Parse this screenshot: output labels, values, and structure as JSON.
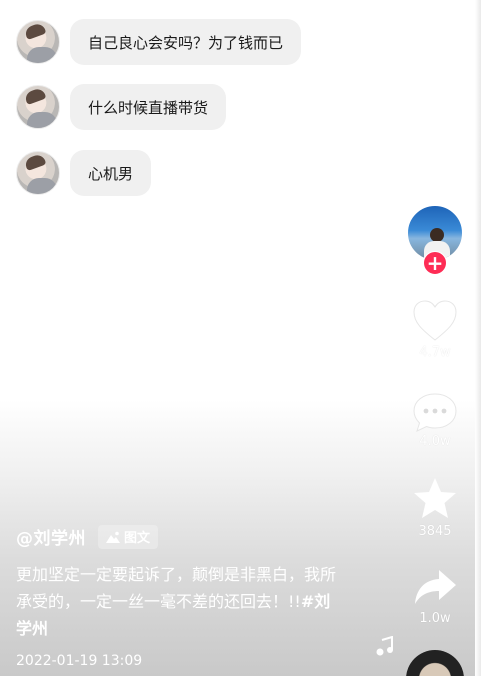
{
  "comments": [
    {
      "text": "自己良心会安吗？为了钱而已",
      "avatar_icon": "user-avatar"
    },
    {
      "text": "什么时候直播带货",
      "avatar_icon": "user-avatar"
    },
    {
      "text": "心机男",
      "avatar_icon": "user-avatar"
    }
  ],
  "rail": {
    "follow_symbol": "+",
    "likes": "4.7w",
    "comments": "4.0w",
    "favorites": "3845",
    "shares": "1.0w",
    "icons": [
      "heart-icon",
      "comment-icon",
      "star-icon",
      "share-icon",
      "music-note-icon"
    ]
  },
  "post": {
    "author": "@刘学州",
    "type_tag": "图文",
    "caption": "更加坚定一定要起诉了，颠倒是非黑白，我所承受的，一定一丝一毫不差的还回去！!!",
    "hashtag": "#刘学州",
    "date": "2022-01-19 13:09"
  },
  "colors": {
    "bubble": "#f0f0f0",
    "follow_accent": "#fe2c55",
    "overlay_text": "#ffffff"
  }
}
